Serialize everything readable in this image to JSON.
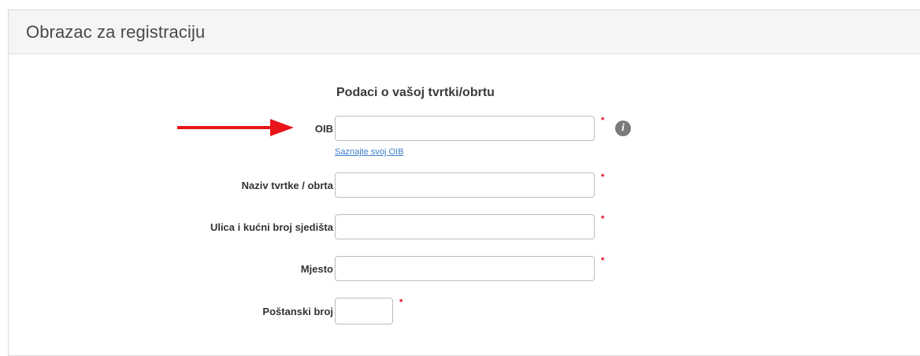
{
  "panel": {
    "title": "Obrazac za registraciju"
  },
  "form": {
    "section_title": "Podaci o vašoj tvrtki/obrtu",
    "required_mark": "*",
    "fields": {
      "oib": {
        "label": "OIB",
        "value": "",
        "placeholder": ""
      },
      "company_name": {
        "label": "Naziv tvrtke / obrta",
        "value": "",
        "placeholder": ""
      },
      "street": {
        "label": "Ulica i kućni broj sjedišta",
        "value": "",
        "placeholder": ""
      },
      "city": {
        "label": "Mjesto",
        "value": "",
        "placeholder": ""
      },
      "postal_code": {
        "label": "Poštanski broj",
        "value": "",
        "placeholder": ""
      }
    },
    "oib_help_link": "Saznajte svoj OIB",
    "info_icon_glyph": "i"
  },
  "colors": {
    "required": "#e2001a",
    "link": "#3b7ec9",
    "arrow": "#e8141a"
  },
  "icons": {
    "info": "info-icon",
    "annotation": "red-arrow"
  }
}
